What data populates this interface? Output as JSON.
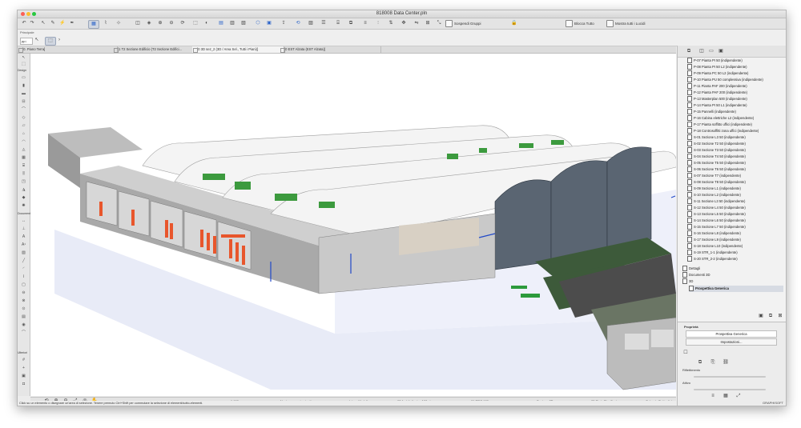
{
  "window": {
    "title": "818008 Data Center.pln"
  },
  "toolbar": {
    "sospendi_gruppi": "Sospendi Gruppi",
    "blocca_tutto": "Blocca Tutto",
    "mostra_tutti_lucidi": "Mostra tutti i Lucidi"
  },
  "infobar": {
    "label": "Principale",
    "field": "pp↓"
  },
  "tabs": [
    "[0. Piano Terra]",
    "[1 T2 Sezione Edificio (T2 Sezione Edifici...",
    "[0 3D sez_2 (3D / Area Sel., Tutti i Piani)]",
    "[0 EST Alzata (EST Alzata)]"
  ],
  "toolbox": {
    "design": "Design",
    "documento": "Documento",
    "ulteriori": "Ulteriori"
  },
  "navigator": {
    "items": [
      "P-07 Pianta PI 50 (indipendente)",
      "P-08 Pianta PI 50 L2 (indipendente)",
      "P-09 Pianta PC 50 L2 (indipendente)",
      "P-10 Pianta PU 50 complessiva (indipendente)",
      "P-11 Pianta PAF 200 (indipendente)",
      "P-12 Pianta PAF 200 (indipendente)",
      "P-13 Masterplan 500 (indipendente)",
      "P-14 Pianta PI 50 L1 (indipendente)",
      "P-15 Pannelli (indipendente)",
      "P-16 Cabina elettriche L2 (indipendente)",
      "P-17 Pianta soffitto uffici (indipendente)",
      "P-18 Controsoffitti zona uffici (indipendente)",
      "S-01 Sezione L3 50 (indipendente)",
      "S-02 Sezione T2 50 (indipendente)",
      "S-03 Sezione T3 50 (indipendente)",
      "S-04 Sezione T4 50 (indipendente)",
      "S-05 Sezione T5 50 (indipendente)",
      "S-06 Sezione T6 50 (indipendente)",
      "S-07 Sezione T7 (indipendente)",
      "S-08 Sezione T8 50 (indipendente)",
      "S-09 Sezione L1 (indipendente)",
      "S-10 Sezione L2 (indipendente)",
      "S-11 Sezione L3 50 (indipendente)",
      "S-12 Sezione L4 50 (indipendente)",
      "S-13 Sezione L5 50 (indipendente)",
      "S-14 Sezione L6 50 (indipendente)",
      "S-15 Sezione L7 50 (indipendente)",
      "S-16 Sezione L8 (indipendente)",
      "S-17 Sezione L9 (indipendente)",
      "S-18 Sezione L10 (indipendente)",
      "S-19 STR_1-1 (indipendente)",
      "S-20 STR_2-2 (indipendente)"
    ],
    "dettagli": "Dettagli",
    "documenti_3d": "Documenti 3D",
    "3d": "3D",
    "prospettiva": "Prospettiva Generica"
  },
  "properties": {
    "header": "Proprietà",
    "name": "Prospettiva Generica",
    "impostazioni": "Impostazioni...",
    "label1": "Riflettimento",
    "label2": "Attivo"
  },
  "statusbar": {
    "scale": "1:100",
    "nav": "Navigare con impianti",
    "modello": "Intero Modello",
    "arch": "03 Architettonico 100 stamp...",
    "prg": "01 PRG 100",
    "sezione": "Sezione 3D",
    "stato": "05 Stato Pianificato",
    "colorato": "Colorato Dettagliato"
  },
  "message": "Click su un elemento o disegnare un'area di selezione. Tenere premuto Ctrl+Shift per commutare la selezione di elementi/sotto-elementi.",
  "brand": "GRAPHISOFT"
}
